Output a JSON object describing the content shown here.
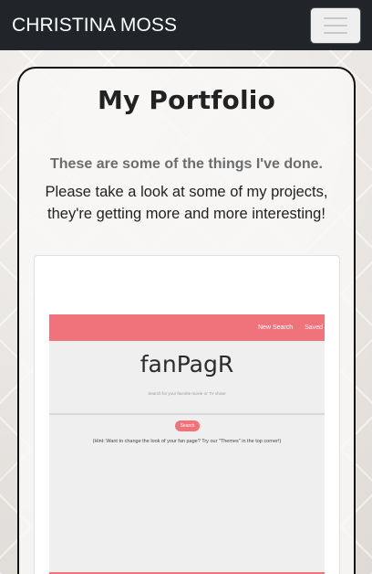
{
  "navbar": {
    "brand": "CHRISTINA MOSS",
    "toggler_icon": "hamburger-menu-icon"
  },
  "portfolio": {
    "title": "My Portfolio",
    "subtitle": "These are some of the things I've done.",
    "description": "Please take a look at some of my projects, they're getting more and more interesting!"
  },
  "project_preview": {
    "nav_links": [
      "New Search",
      "Saved"
    ],
    "app_title": "fanPagR",
    "search_placeholder": "Search for your favorite movie or TV show!",
    "search_button": "Search",
    "hint": "(Hint: Want to change the look of your fan page? Try our \"Themes\" in the top corner!)",
    "accent_color": "#f0727a"
  }
}
